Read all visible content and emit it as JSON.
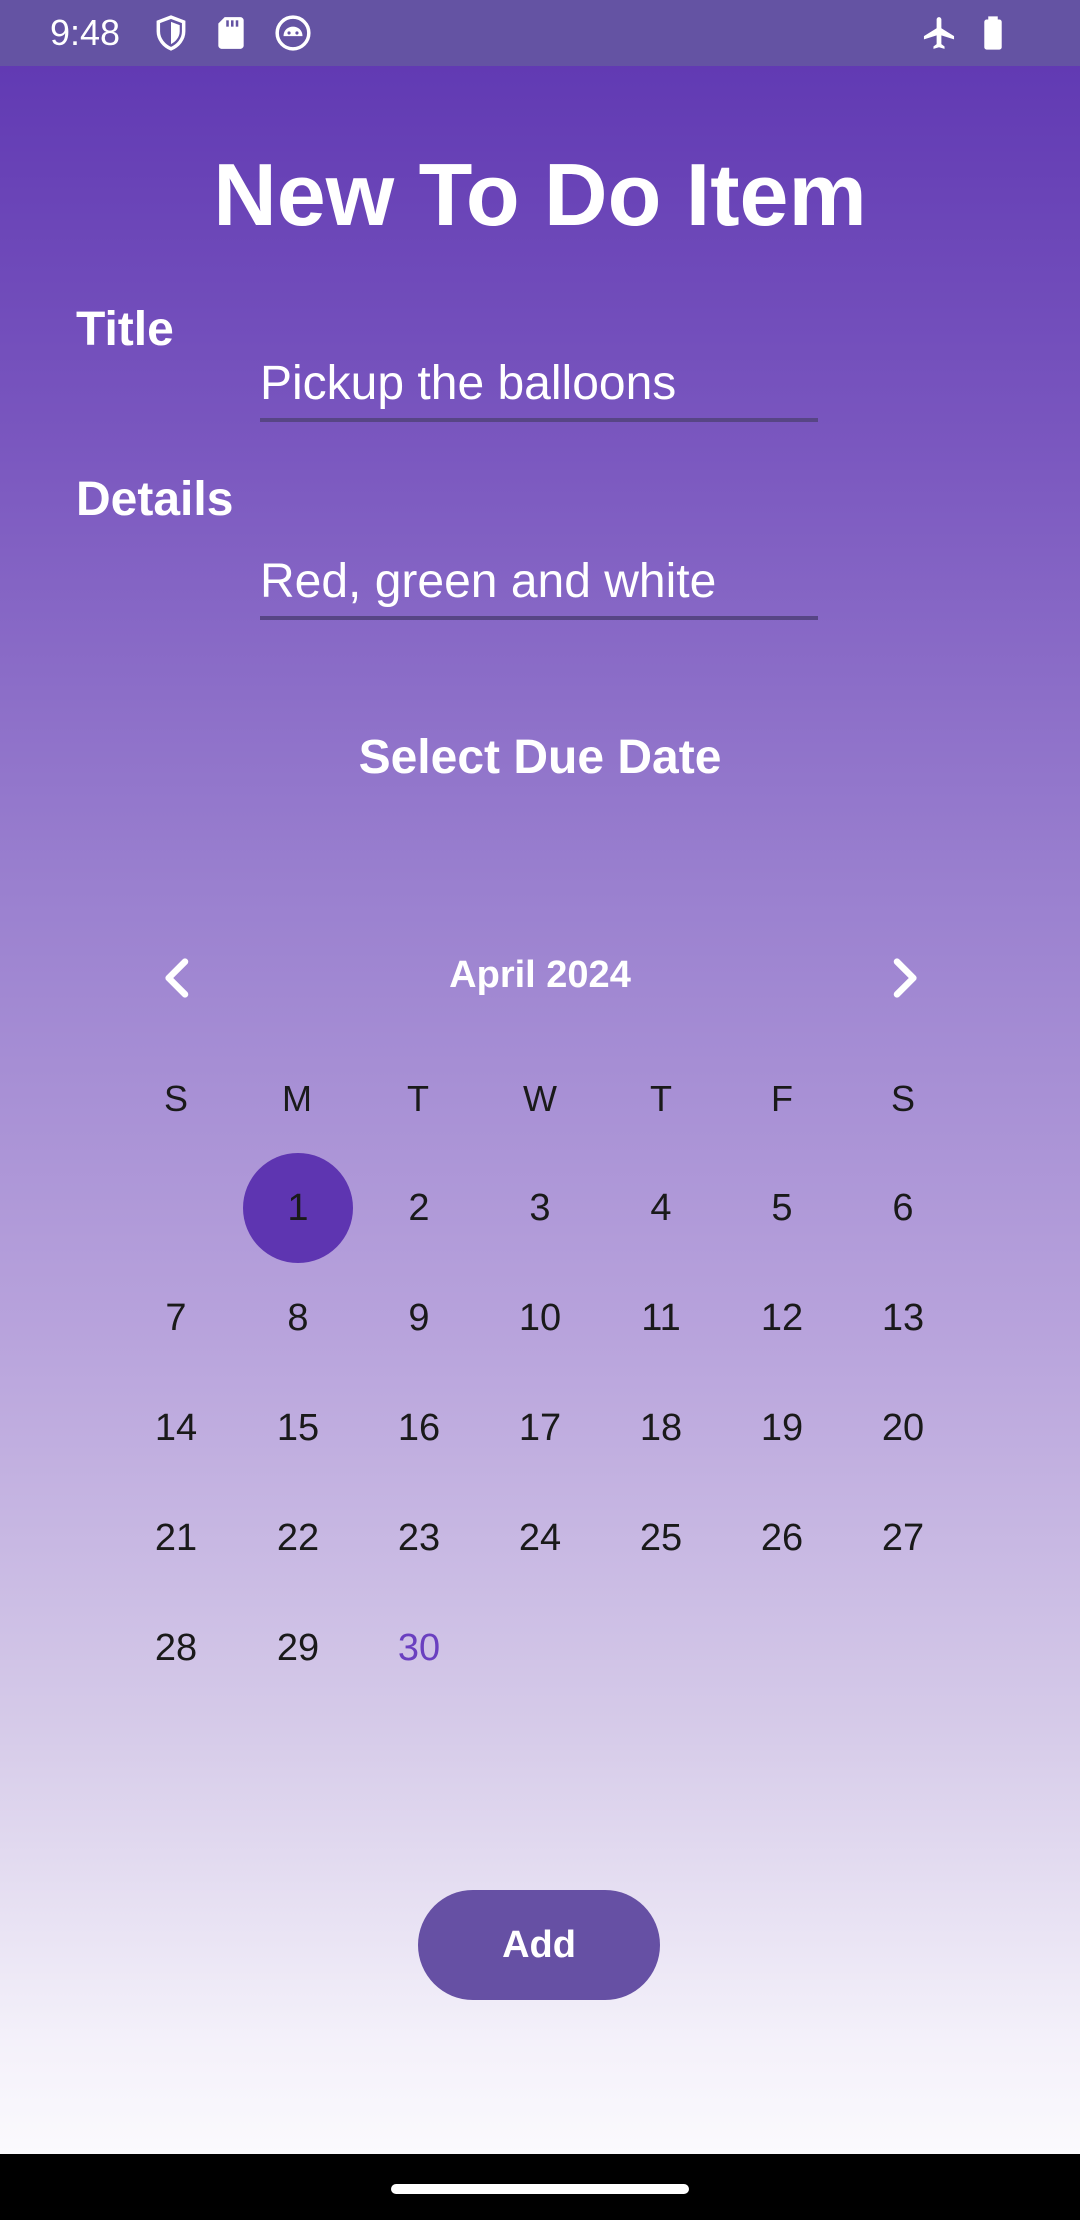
{
  "status_bar": {
    "time": "9:48",
    "left_icons": [
      "shield-icon",
      "sd-card-icon",
      "android-face-icon"
    ],
    "right_icons": [
      "airplane-mode-icon",
      "battery-icon"
    ]
  },
  "page": {
    "title": "New To Do Item"
  },
  "form": {
    "title_label": "Title",
    "title_value": "Pickup the balloons",
    "details_label": "Details",
    "details_value": "Red, green and white"
  },
  "due_date": {
    "section_label": "Select Due Date",
    "month_label": "April 2024",
    "prev_icon": "chevron-left-icon",
    "next_icon": "chevron-right-icon",
    "weekdays": [
      "S",
      "M",
      "T",
      "W",
      "T",
      "F",
      "S"
    ],
    "days": [
      "1",
      "2",
      "3",
      "4",
      "5",
      "6",
      "7",
      "8",
      "9",
      "10",
      "11",
      "12",
      "13",
      "14",
      "15",
      "16",
      "17",
      "18",
      "19",
      "20",
      "21",
      "22",
      "23",
      "24",
      "25",
      "26",
      "27",
      "28",
      "29",
      "30"
    ],
    "selected_day": "1",
    "today_day": "30"
  },
  "actions": {
    "add_label": "Add"
  },
  "colors": {
    "accent": "#5e35b1",
    "button": "#6650a4",
    "today": "#6a3fc0"
  }
}
